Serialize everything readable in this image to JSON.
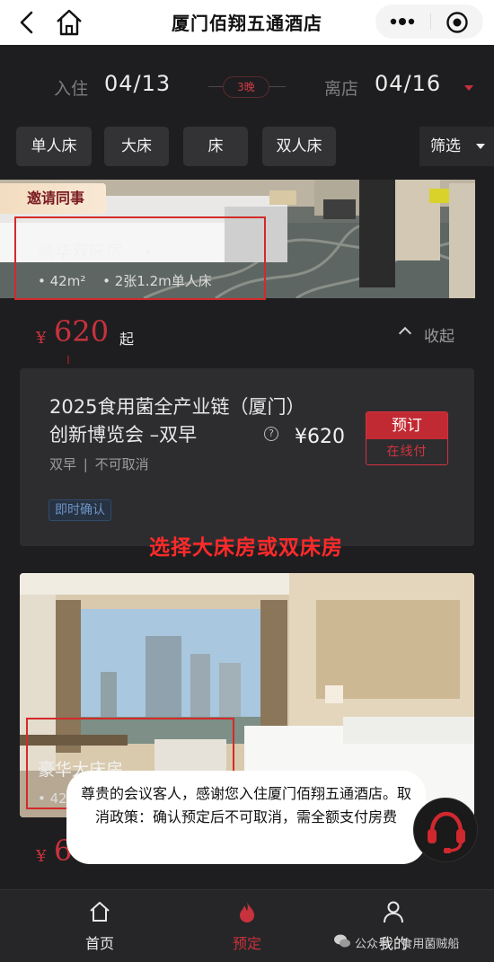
{
  "header": {
    "title": "厦门佰翔五通酒店",
    "back_icon": "back-arrow-icon",
    "home_icon": "home-icon",
    "more_icon": "more-dots-icon",
    "close_icon": "target-close-icon"
  },
  "dates": {
    "checkin_label": "入住",
    "checkin_value": "04/13",
    "nights": "3晚",
    "checkout_label": "离店",
    "checkout_value": "04/16"
  },
  "filters": {
    "chips": [
      "单人床",
      "大床",
      "床",
      "双人床"
    ],
    "filter_label": "筛选"
  },
  "room1": {
    "badge": "邀请同事",
    "name": "豪华双床房",
    "area": "• 42m²",
    "beds": "• 2张1.2m单人床",
    "price_symbol": "¥",
    "price": "620",
    "price_suffix": "起",
    "collapse_label": "收起"
  },
  "rate_plan": {
    "name": "2025食用菌全产业链（厦门）创新博览会 –双早",
    "price": "¥620",
    "meal": "双早",
    "divider": "|",
    "cancel_policy": "不可取消",
    "tag": "即时确认",
    "book_label": "预订",
    "pay_label": "在线付"
  },
  "annotation": "选择大床房或双床房",
  "room2": {
    "name": "豪华大床房",
    "info": "• 42",
    "price_symbol": "¥",
    "price": "6"
  },
  "toast": {
    "message": "尊贵的会议客人，感谢您入住厦门佰翔五通酒店。取消政策：确认预定后不可取消，需全额支付房费"
  },
  "tabbar": {
    "home": "首页",
    "book": "预定",
    "mine": "我的"
  },
  "watermark": "公众号 · 食用菌贼船",
  "colors": {
    "accent_red": "#c8323c",
    "annotation_red": "#ff2a2a",
    "background": "#1e1e20",
    "card": "#2d2d30"
  }
}
